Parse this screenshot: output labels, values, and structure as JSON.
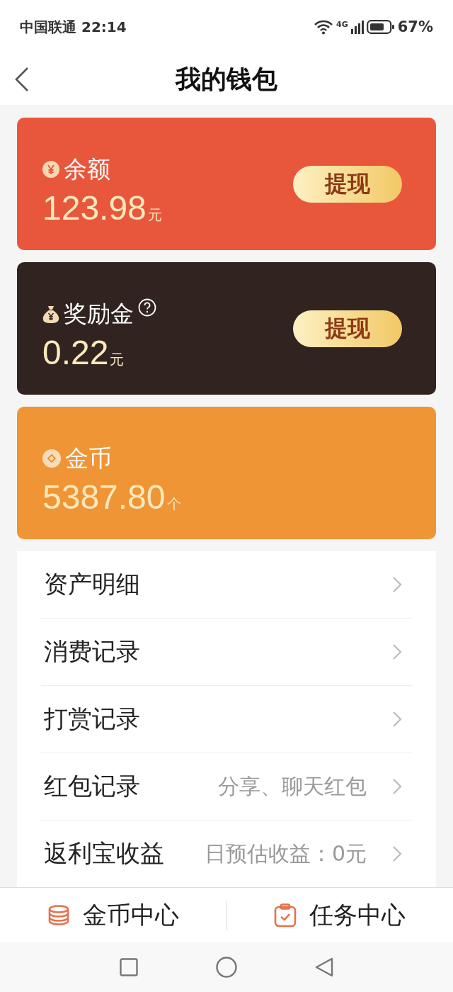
{
  "status_bar": {
    "carrier": "中国联通",
    "time": "22:14",
    "network": "4G",
    "battery": "67%"
  },
  "header": {
    "title": "我的钱包"
  },
  "cards": [
    {
      "kind": "yen",
      "label": "余额",
      "help": false,
      "amount": "123.98",
      "unit": "元",
      "button": "提现",
      "color": "#e8573c"
    },
    {
      "kind": "bag",
      "label": "奖励金",
      "help": true,
      "amount": "0.22",
      "unit": "元",
      "button": "提现",
      "color": "#312420"
    },
    {
      "kind": "coin",
      "label": "金币",
      "help": false,
      "amount": "5387.80",
      "unit": "个",
      "color": "#ef9535"
    }
  ],
  "menu": [
    {
      "label": "资产明细"
    },
    {
      "label": "消费记录"
    },
    {
      "label": "打赏记录"
    },
    {
      "label": "红包记录",
      "hint": "分享、聊天红包"
    },
    {
      "label": "返利宝收益",
      "hint": "日预估收益：0元"
    }
  ],
  "bottom_tabs": [
    {
      "kind": "coins",
      "label": "金币中心"
    },
    {
      "kind": "task",
      "label": "任务中心"
    }
  ]
}
